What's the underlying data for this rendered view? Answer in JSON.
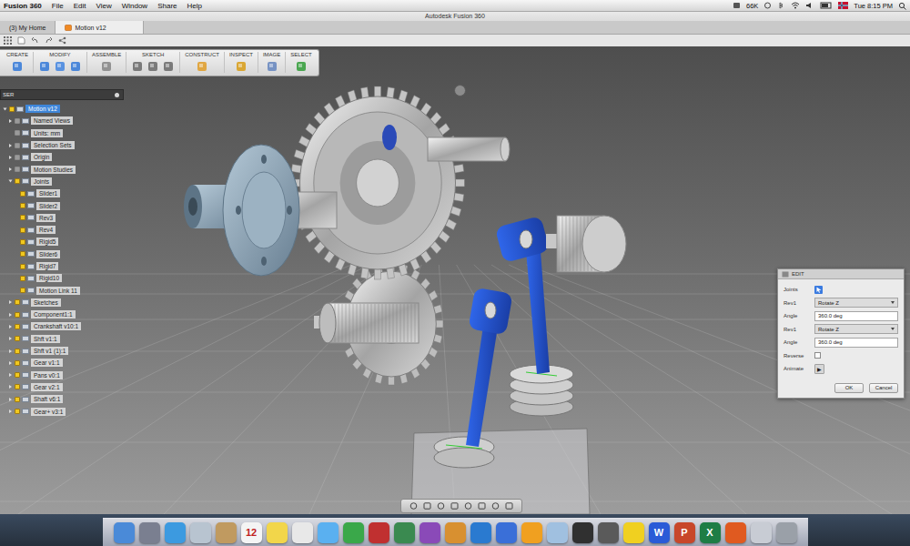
{
  "menubar": {
    "app": "Fusion 360",
    "items": [
      "File",
      "Edit",
      "View",
      "Window",
      "Share",
      "Help"
    ],
    "status": "66K",
    "clock": "Tue 8:15 PM"
  },
  "window": {
    "title": "Autodesk Fusion 360"
  },
  "tabs": [
    {
      "label": "(3) My Home",
      "selected": false
    },
    {
      "label": "Motion v12",
      "selected": true
    }
  ],
  "toolbar": [
    "CREATE",
    "MODIFY",
    "ASSEMBLE",
    "SKETCH",
    "CONSTRUCT",
    "INSPECT",
    "IMAGE",
    "SELECT"
  ],
  "browser": {
    "title": "SER",
    "tree": [
      {
        "label": "Motion v12",
        "visible": true,
        "selected": true,
        "expanded": true,
        "children": [
          {
            "label": "Named Views",
            "visible": false,
            "selected": false,
            "expanded": false
          },
          {
            "label": "Units: mm",
            "visible": false,
            "selected": false
          },
          {
            "label": "Selection Sets",
            "visible": false,
            "selected": false,
            "expanded": false
          },
          {
            "label": "Origin",
            "visible": false,
            "selected": false,
            "expanded": false
          },
          {
            "label": "Motion Studies",
            "visible": false,
            "selected": false,
            "expanded": false
          },
          {
            "label": "Joints",
            "visible": true,
            "selected": false,
            "expanded": true,
            "children": [
              {
                "label": "Slider1",
                "visible": true,
                "selected": false
              },
              {
                "label": "Slider2",
                "visible": true,
                "selected": false
              },
              {
                "label": "Rev3",
                "visible": true,
                "selected": false
              },
              {
                "label": "Rev4",
                "visible": true,
                "selected": false
              },
              {
                "label": "Rigid5",
                "visible": true,
                "selected": false
              },
              {
                "label": "Slider6",
                "visible": true,
                "selected": false
              },
              {
                "label": "Rigid7",
                "visible": true,
                "selected": false
              },
              {
                "label": "Rigid10",
                "visible": true,
                "selected": false
              },
              {
                "label": "Motion Link 11",
                "visible": true,
                "selected": false
              }
            ]
          },
          {
            "label": "Sketches",
            "visible": true,
            "selected": false,
            "expanded": false
          },
          {
            "label": "Component1:1",
            "visible": true,
            "selected": false,
            "expanded": false
          },
          {
            "label": "Crankshaft v10:1",
            "visible": true,
            "selected": false,
            "expanded": false
          },
          {
            "label": "Shft v1:1",
            "visible": true,
            "selected": false,
            "expanded": false
          },
          {
            "label": "Shft v1 (1):1",
            "visible": true,
            "selected": false,
            "expanded": false
          },
          {
            "label": "Gear v1:1",
            "visible": true,
            "selected": false,
            "expanded": false
          },
          {
            "label": "Pans v0:1",
            "visible": true,
            "selected": false,
            "expanded": false
          },
          {
            "label": "Gear v2:1",
            "visible": true,
            "selected": false,
            "expanded": false
          },
          {
            "label": "Shaft v6:1",
            "visible": true,
            "selected": false,
            "expanded": false
          },
          {
            "label": "Gear+ v3:1",
            "visible": true,
            "selected": false,
            "expanded": false
          }
        ]
      }
    ]
  },
  "edit_dialog": {
    "title": "EDIT",
    "rows": [
      {
        "kind": "pick",
        "label": "Joints",
        "selected": true
      },
      {
        "kind": "select",
        "label": "Rev1",
        "value": "Rotate Z"
      },
      {
        "kind": "field",
        "label": "Angle",
        "value": "360.0 deg"
      },
      {
        "kind": "select",
        "label": "Rev1",
        "value": "Rotate Z"
      },
      {
        "kind": "field",
        "label": "Angle",
        "value": "360.0 deg"
      },
      {
        "kind": "checkbox",
        "label": "Reverse",
        "checked": false
      },
      {
        "kind": "play",
        "label": "Animate",
        "value": "▶"
      }
    ],
    "buttons": [
      "OK",
      "Cancel"
    ]
  },
  "dock": [
    {
      "color": "#4a8ad8"
    },
    {
      "color": "#7a7f90"
    },
    {
      "color": "#3c9ae0"
    },
    {
      "color": "#b8c4d0"
    },
    {
      "color": "#c09a60"
    },
    {
      "color": "#f4f4f4",
      "glyph": "12"
    },
    {
      "color": "#f2d64a"
    },
    {
      "color": "#e8e8e8"
    },
    {
      "color": "#5ab0f0"
    },
    {
      "color": "#3aa84a"
    },
    {
      "color": "#c03030"
    },
    {
      "color": "#3a8a50"
    },
    {
      "color": "#8a4ab8"
    },
    {
      "color": "#d89030"
    },
    {
      "color": "#2a7ad0"
    },
    {
      "color": "#3a6fd8"
    },
    {
      "color": "#f0a020"
    },
    {
      "color": "#a0c0e0"
    },
    {
      "color": "#303030"
    },
    {
      "color": "#5a5a5a"
    },
    {
      "color": "#f0d020"
    },
    {
      "color": "#2a5bd7",
      "glyph": "W"
    },
    {
      "color": "#c8472a",
      "glyph": "P"
    },
    {
      "color": "#1e7d45",
      "glyph": "X"
    },
    {
      "color": "#e05a20"
    },
    {
      "color": "#c8ccd4"
    },
    {
      "color": "#9aa0a8"
    }
  ]
}
